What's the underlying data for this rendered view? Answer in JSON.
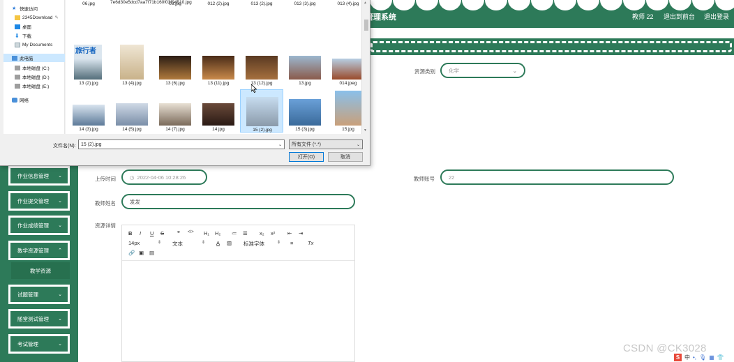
{
  "header": {
    "title": "管理系统",
    "nav": [
      "教师 22",
      "退出到前台",
      "退出登录"
    ]
  },
  "form": {
    "resource_type_label": "资源类别",
    "resource_type_value": "化学",
    "upload_time_label": "上传时间",
    "upload_time_value": "2022-04-06 10:28:26",
    "teacher_account_label": "教师账号",
    "teacher_account_value": "22",
    "teacher_name_label": "教师姓名",
    "teacher_name_value": "发发",
    "detail_label": "资源详情"
  },
  "editor": {
    "row1": [
      "B",
      "I",
      "U",
      "S",
      "❞",
      "</>",
      "H₁",
      "H₂",
      "≔",
      "☰",
      "x₂",
      "x²",
      "⇤",
      "⇥"
    ],
    "font_size": "14px",
    "text_style": "文本",
    "font_family": "标准字体",
    "clear": "Tx"
  },
  "sidebar": {
    "items": [
      "作业信息管理",
      "作业提交管理",
      "作业成绩管理",
      "教学资源管理",
      "试题管理",
      "随堂测试管理",
      "考试管理"
    ],
    "sub_item": "教学资源"
  },
  "dialog": {
    "nav": [
      {
        "label": "快速访问",
        "icon": "star-icon"
      },
      {
        "label": "2345Download",
        "icon": "folder-icon"
      },
      {
        "label": "桌面",
        "icon": "desktop-icon"
      },
      {
        "label": "下载",
        "icon": "download-icon"
      },
      {
        "label": "My Documents",
        "icon": "documents-icon"
      },
      {
        "label": "此电脑",
        "icon": "computer-icon"
      },
      {
        "label": "本地磁盘 (C:)",
        "icon": "drive-icon"
      },
      {
        "label": "本地磁盘 (D:)",
        "icon": "drive-icon"
      },
      {
        "label": "本地磁盘 (E:)",
        "icon": "drive-icon"
      },
      {
        "label": "网络",
        "icon": "network-icon"
      }
    ],
    "files": [
      [
        "06.jpg",
        "7e6d30e5dcd7aa7f71b160f03f04510.jpg",
        "08.jpg",
        "012 (2).jpg",
        "013 (2).jpg",
        "013 (3).jpg",
        "013 (4).jpg"
      ],
      [
        "13 (2).jpg",
        "13 (4).jpg",
        "13 (6).jpg",
        "13 (11).jpg",
        "13 (12).jpg",
        "13.jpg",
        "014.jpeg"
      ],
      [
        "14 (3).jpg",
        "14 (5).jpg",
        "14 (7).jpg",
        "14.jpg",
        "15 (2).jpg",
        "15 (3).jpg",
        "15.jpg"
      ]
    ],
    "tile_thumb": "旅行者",
    "filename_label": "文件名(N):",
    "filename_value": "15 (2).jpg",
    "filetype_value": "所有文件 (*.*)",
    "open_button": "打开(O)",
    "cancel_button": "取消"
  },
  "watermark": "CSDN @CK3028",
  "ime": {
    "s": "S",
    "mode": "中"
  },
  "colors": {
    "primary": "#2d7a59",
    "selection": "#cce8ff"
  }
}
